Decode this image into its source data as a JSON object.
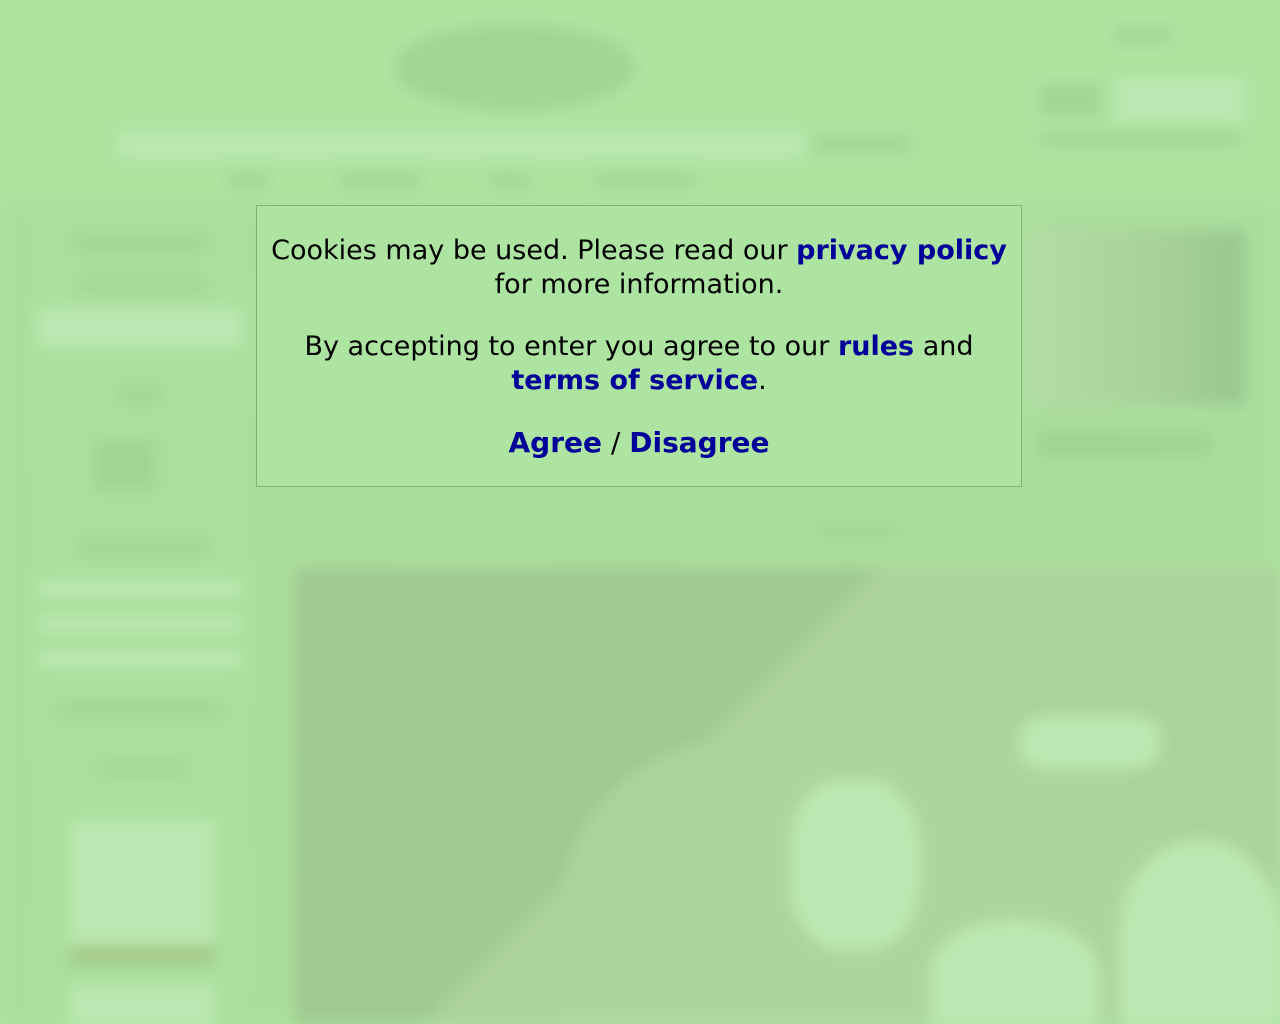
{
  "modal": {
    "line1_pre": "Cookies may be used. Please read our ",
    "privacy_link": "privacy policy",
    "line1_post": " for more information.",
    "line2_pre": "By accepting to enter you agree to our ",
    "rules_link": "rules",
    "line2_mid": " and ",
    "tos_link": "terms of service",
    "line2_post": ".",
    "agree": "Agree",
    "separator": " / ",
    "disagree": "Disagree"
  },
  "colors": {
    "background": "#ade4a1",
    "link": "#000099",
    "modal_border": "#80b577"
  }
}
